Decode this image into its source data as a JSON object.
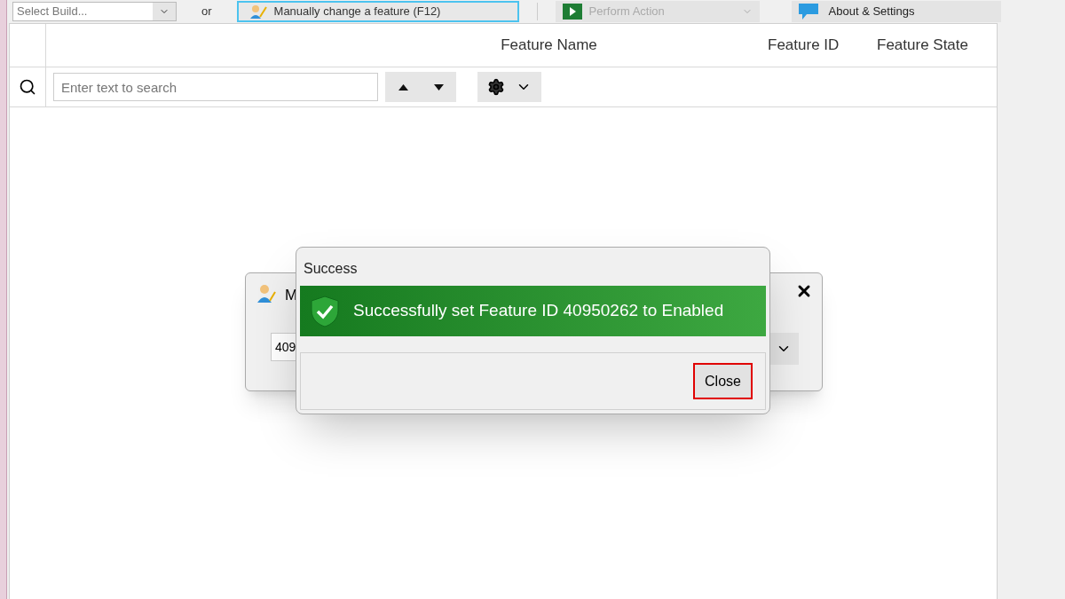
{
  "toolbar": {
    "build_select": {
      "value": "Select Build..."
    },
    "separator_text": "or",
    "manual_button": {
      "label": "Manually change a feature (F12)",
      "selected": true
    },
    "action_button": {
      "label": "Perform Action",
      "disabled": true
    },
    "about_button": {
      "label": "About & Settings"
    }
  },
  "table": {
    "columns": [
      "Feature Name",
      "Feature ID",
      "Feature State"
    ],
    "search": {
      "placeholder": "Enter text to search"
    }
  },
  "background_dialog": {
    "title": "M",
    "value": "409"
  },
  "success_dialog": {
    "title": "Success",
    "message": "Successfully set Feature ID 40950262 to Enabled",
    "close_button": {
      "label": "Close",
      "focused": true
    }
  }
}
